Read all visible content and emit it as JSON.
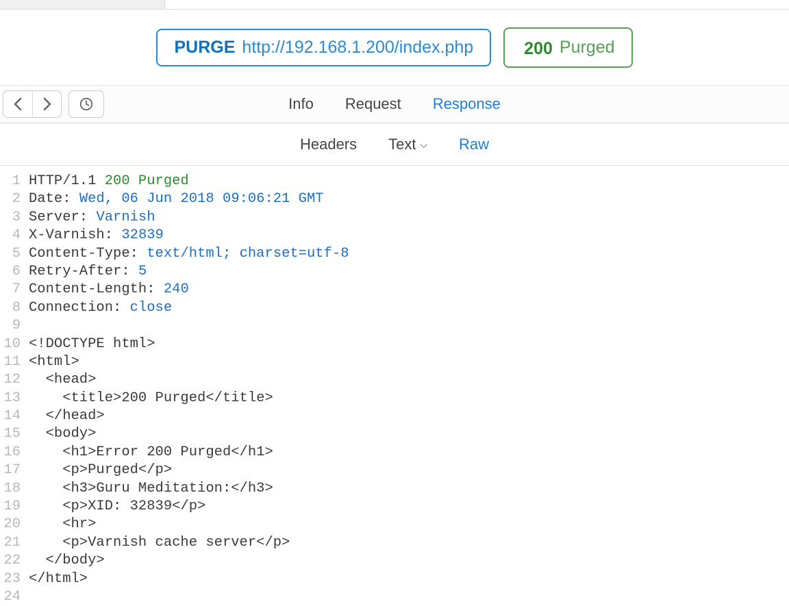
{
  "request_pill": {
    "method": "PURGE",
    "url": "http://192.168.1.200/index.php"
  },
  "status_pill": {
    "code": "200",
    "text": "Purged"
  },
  "main_tabs": {
    "info": "Info",
    "request": "Request",
    "response": "Response"
  },
  "sub_tabs": {
    "headers": "Headers",
    "text": "Text",
    "raw": "Raw"
  },
  "code_lines": [
    {
      "n": 1,
      "segs": [
        [
          "",
          "HTTP/1.1 "
        ],
        [
          "green",
          "200 Purged"
        ]
      ]
    },
    {
      "n": 2,
      "segs": [
        [
          "key",
          "Date:"
        ],
        [
          "",
          " "
        ],
        [
          "blue",
          "Wed, 06 Jun 2018 09:06:21 GMT"
        ]
      ]
    },
    {
      "n": 3,
      "segs": [
        [
          "key",
          "Server:"
        ],
        [
          "",
          " "
        ],
        [
          "blue",
          "Varnish"
        ]
      ]
    },
    {
      "n": 4,
      "segs": [
        [
          "key",
          "X-Varnish:"
        ],
        [
          "",
          " "
        ],
        [
          "blue",
          "32839"
        ]
      ]
    },
    {
      "n": 5,
      "segs": [
        [
          "key",
          "Content-Type:"
        ],
        [
          "",
          " "
        ],
        [
          "blue",
          "text/html; charset=utf-8"
        ]
      ]
    },
    {
      "n": 6,
      "segs": [
        [
          "key",
          "Retry-After:"
        ],
        [
          "",
          " "
        ],
        [
          "blue",
          "5"
        ]
      ]
    },
    {
      "n": 7,
      "segs": [
        [
          "key",
          "Content-Length:"
        ],
        [
          "",
          " "
        ],
        [
          "blue",
          "240"
        ]
      ]
    },
    {
      "n": 8,
      "segs": [
        [
          "key",
          "Connection:"
        ],
        [
          "",
          " "
        ],
        [
          "blue",
          "close"
        ]
      ]
    },
    {
      "n": 9,
      "segs": [
        [
          "",
          ""
        ]
      ]
    },
    {
      "n": 10,
      "segs": [
        [
          "",
          "<!DOCTYPE html>"
        ]
      ]
    },
    {
      "n": 11,
      "segs": [
        [
          "",
          "<html>"
        ]
      ]
    },
    {
      "n": 12,
      "segs": [
        [
          "",
          "  <head>"
        ]
      ]
    },
    {
      "n": 13,
      "segs": [
        [
          "",
          "    <title>200 Purged</title>"
        ]
      ]
    },
    {
      "n": 14,
      "segs": [
        [
          "",
          "  </head>"
        ]
      ]
    },
    {
      "n": 15,
      "segs": [
        [
          "",
          "  <body>"
        ]
      ]
    },
    {
      "n": 16,
      "segs": [
        [
          "",
          "    <h1>Error 200 Purged</h1>"
        ]
      ]
    },
    {
      "n": 17,
      "segs": [
        [
          "",
          "    <p>Purged</p>"
        ]
      ]
    },
    {
      "n": 18,
      "segs": [
        [
          "",
          "    <h3>Guru Meditation:</h3>"
        ]
      ]
    },
    {
      "n": 19,
      "segs": [
        [
          "",
          "    <p>XID: 32839</p>"
        ]
      ]
    },
    {
      "n": 20,
      "segs": [
        [
          "",
          "    <hr>"
        ]
      ]
    },
    {
      "n": 21,
      "segs": [
        [
          "",
          "    <p>Varnish cache server</p>"
        ]
      ]
    },
    {
      "n": 22,
      "segs": [
        [
          "",
          "  </body>"
        ]
      ]
    },
    {
      "n": 23,
      "segs": [
        [
          "",
          "</html>"
        ]
      ]
    },
    {
      "n": 24,
      "segs": [
        [
          "",
          ""
        ]
      ]
    }
  ]
}
